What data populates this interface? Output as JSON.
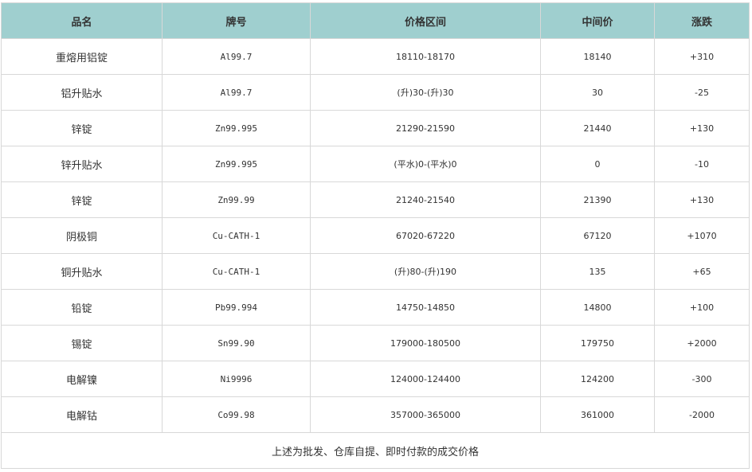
{
  "table": {
    "headers": [
      "品名",
      "牌号",
      "价格区间",
      "中间价",
      "涨跌"
    ],
    "rows": [
      {
        "name": "重熔用铝锭",
        "grade": "Al99.7",
        "range": "18110-18170",
        "mid": "18140",
        "change": "+310"
      },
      {
        "name": "铝升贴水",
        "grade": "Al99.7",
        "range": "(升)30-(升)30",
        "mid": "30",
        "change": "-25"
      },
      {
        "name": "锌锭",
        "grade": "Zn99.995",
        "range": "21290-21590",
        "mid": "21440",
        "change": "+130"
      },
      {
        "name": "锌升贴水",
        "grade": "Zn99.995",
        "range": "(平水)0-(平水)0",
        "mid": "0",
        "change": "-10"
      },
      {
        "name": "锌锭",
        "grade": "Zn99.99",
        "range": "21240-21540",
        "mid": "21390",
        "change": "+130"
      },
      {
        "name": "阴极铜",
        "grade": "Cu-CATH-1",
        "range": "67020-67220",
        "mid": "67120",
        "change": "+1070"
      },
      {
        "name": "铜升贴水",
        "grade": "Cu-CATH-1",
        "range": "(升)80-(升)190",
        "mid": "135",
        "change": "+65"
      },
      {
        "name": "铅锭",
        "grade": "Pb99.994",
        "range": "14750-14850",
        "mid": "14800",
        "change": "+100"
      },
      {
        "name": "锡锭",
        "grade": "Sn99.90",
        "range": "179000-180500",
        "mid": "179750",
        "change": "+2000"
      },
      {
        "name": "电解镍",
        "grade": "Ni9996",
        "range": "124000-124400",
        "mid": "124200",
        "change": "-300"
      },
      {
        "name": "电解钴",
        "grade": "Co99.98",
        "range": "357000-365000",
        "mid": "361000",
        "change": "-2000"
      }
    ],
    "footnote": "上述为批发、仓库自提、即时付款的成交价格"
  }
}
